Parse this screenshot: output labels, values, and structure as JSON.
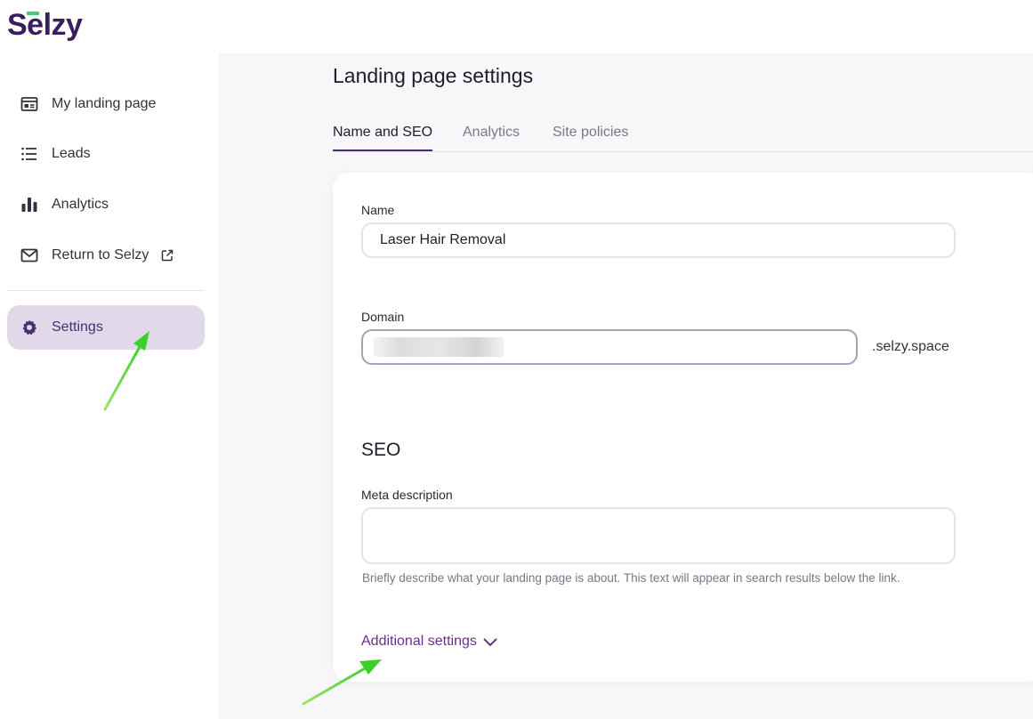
{
  "brand": {
    "logo_text": "Selzy",
    "accent": "#3cd070",
    "primary": "#4a2d72"
  },
  "sidebar": {
    "items": [
      {
        "label": "My landing page",
        "icon": "landing-page-icon"
      },
      {
        "label": "Leads",
        "icon": "list-icon"
      },
      {
        "label": "Analytics",
        "icon": "bar-chart-icon"
      },
      {
        "label": "Return to Selzy",
        "icon": "mail-icon",
        "external_icon": "external-link-icon"
      },
      {
        "label": "Settings",
        "icon": "gear-icon",
        "active": true
      }
    ]
  },
  "page": {
    "title": "Landing page settings",
    "tabs": [
      {
        "label": "Name and SEO",
        "active": true
      },
      {
        "label": "Analytics",
        "active": false
      },
      {
        "label": "Site policies",
        "active": false
      }
    ]
  },
  "form": {
    "name": {
      "label": "Name",
      "value": "Laser Hair Removal"
    },
    "domain": {
      "label": "Domain",
      "value": "",
      "suffix": ".selzy.space"
    },
    "seo": {
      "title": "SEO",
      "meta_label": "Meta description",
      "meta_value": "",
      "hint": "Briefly describe what your landing page is about. This text will appear in search results below the link."
    },
    "additional_settings": "Additional settings"
  }
}
